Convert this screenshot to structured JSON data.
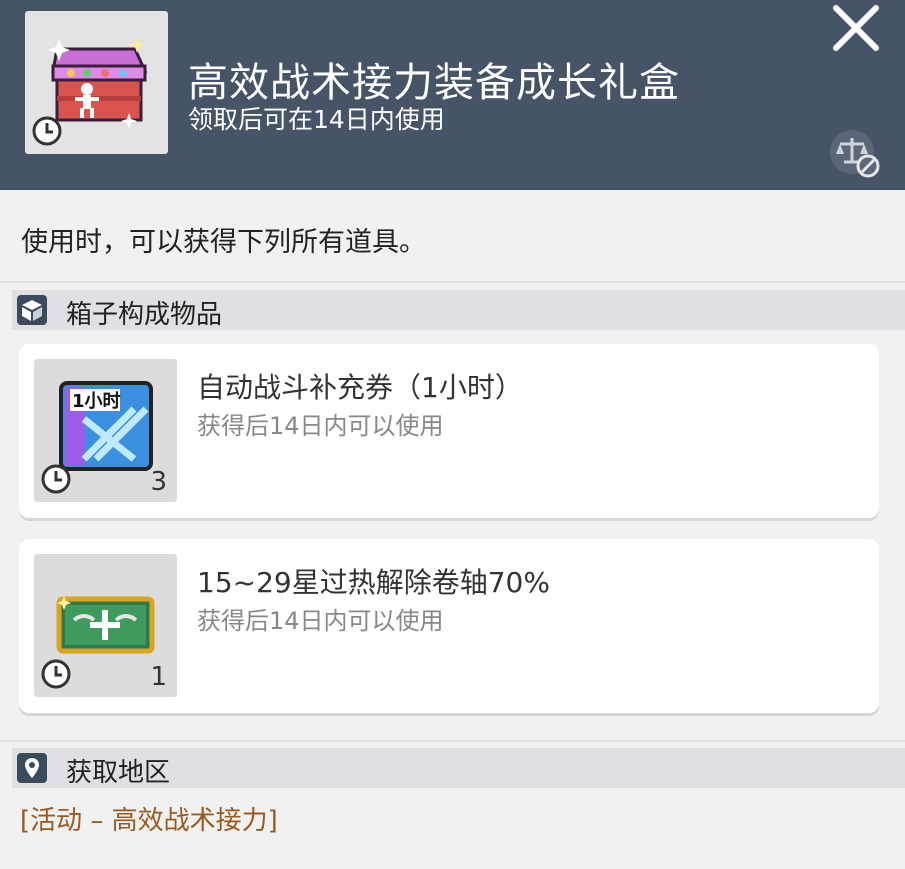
{
  "header": {
    "title": "高效战术接力装备成长礼盒",
    "subtitle": "领取后可在14日内使用",
    "close_icon": "close-icon",
    "compare_icon": "scale-icon",
    "colors": {
      "background": "#475467",
      "text": "#ffffff"
    }
  },
  "description": "使用时，可以获得下列所有道具。",
  "contents_section": {
    "title": "箱子构成物品",
    "icon": "box-icon",
    "items": [
      {
        "name": "自动战斗补充券（1小时）",
        "subtitle": "获得后14日内可以使用",
        "quantity": "3",
        "icon": "auto-battle-ticket-icon"
      },
      {
        "name": "15~29星过热解除卷轴70%",
        "subtitle": "获得后14日内可以使用",
        "quantity": "1",
        "icon": "scroll-icon"
      }
    ]
  },
  "source_section": {
    "title": "获取地区",
    "icon": "location-pin-icon",
    "link": "[活动 – 高效战术接力]",
    "link_color": "#9a5a1f"
  }
}
